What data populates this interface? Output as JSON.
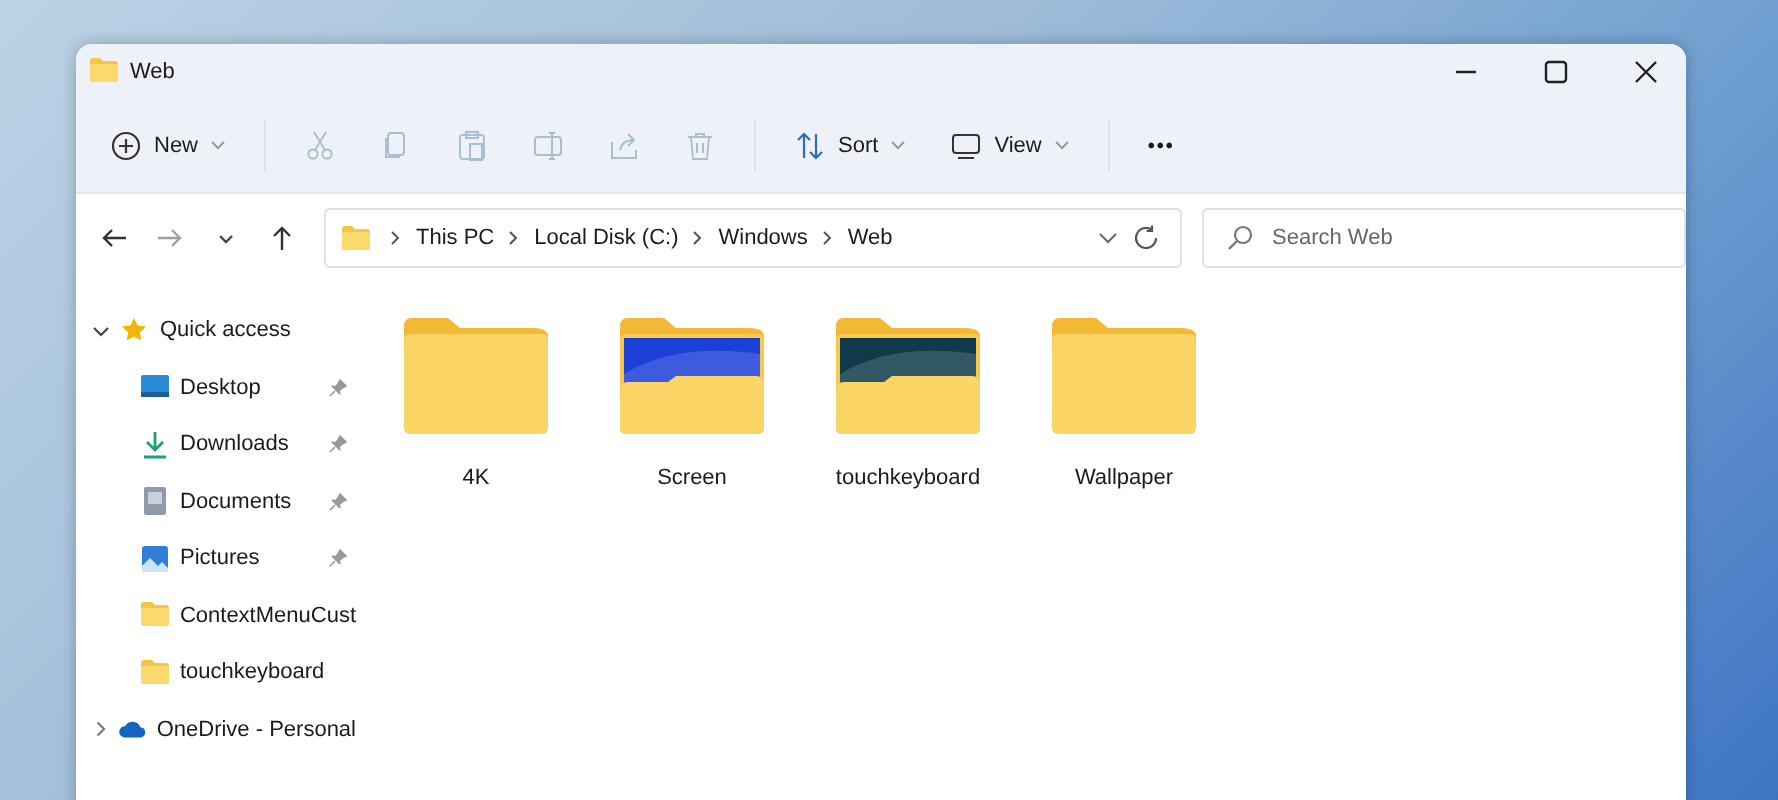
{
  "window": {
    "title": "Web"
  },
  "toolbar": [
    {
      "kind": "new",
      "label": "New",
      "disabled": false
    },
    {
      "kind": "cut",
      "disabled": true
    },
    {
      "kind": "copy",
      "disabled": true
    },
    {
      "kind": "paste",
      "disabled": true
    },
    {
      "kind": "rename",
      "disabled": true
    },
    {
      "kind": "share",
      "disabled": true
    },
    {
      "kind": "delete",
      "disabled": true
    },
    {
      "kind": "sort",
      "label": "Sort",
      "disabled": false
    },
    {
      "kind": "view",
      "label": "View",
      "disabled": false
    },
    {
      "kind": "more",
      "label": "•••",
      "disabled": false
    }
  ],
  "address_bar": {
    "path": [
      "This PC",
      "Local Disk (C:)",
      "Windows",
      "Web"
    ]
  },
  "search": {
    "placeholder": "Search Web"
  },
  "sidebar": {
    "items": [
      {
        "kind": "star",
        "label": "Quick access",
        "expanded": true,
        "children": [
          {
            "kind": "desktop",
            "label": "Desktop",
            "pinned": true
          },
          {
            "kind": "download",
            "label": "Downloads",
            "pinned": true
          },
          {
            "kind": "document",
            "label": "Documents",
            "pinned": true
          },
          {
            "kind": "picture",
            "label": "Pictures",
            "pinned": true
          },
          {
            "kind": "folder",
            "label": "ContextMenuCust",
            "pinned": false
          },
          {
            "kind": "folder",
            "label": "touchkeyboard",
            "pinned": false
          }
        ]
      },
      {
        "kind": "cloud",
        "label": "OneDrive - Personal",
        "expanded": false
      }
    ]
  },
  "folders": [
    {
      "name": "4K",
      "kind": "plain"
    },
    {
      "name": "Screen",
      "kind": "preview",
      "color": "#1c3fd8"
    },
    {
      "name": "touchkeyboard",
      "kind": "preview",
      "color": "#0f3a4a"
    },
    {
      "name": "Wallpaper",
      "kind": "plain"
    }
  ]
}
